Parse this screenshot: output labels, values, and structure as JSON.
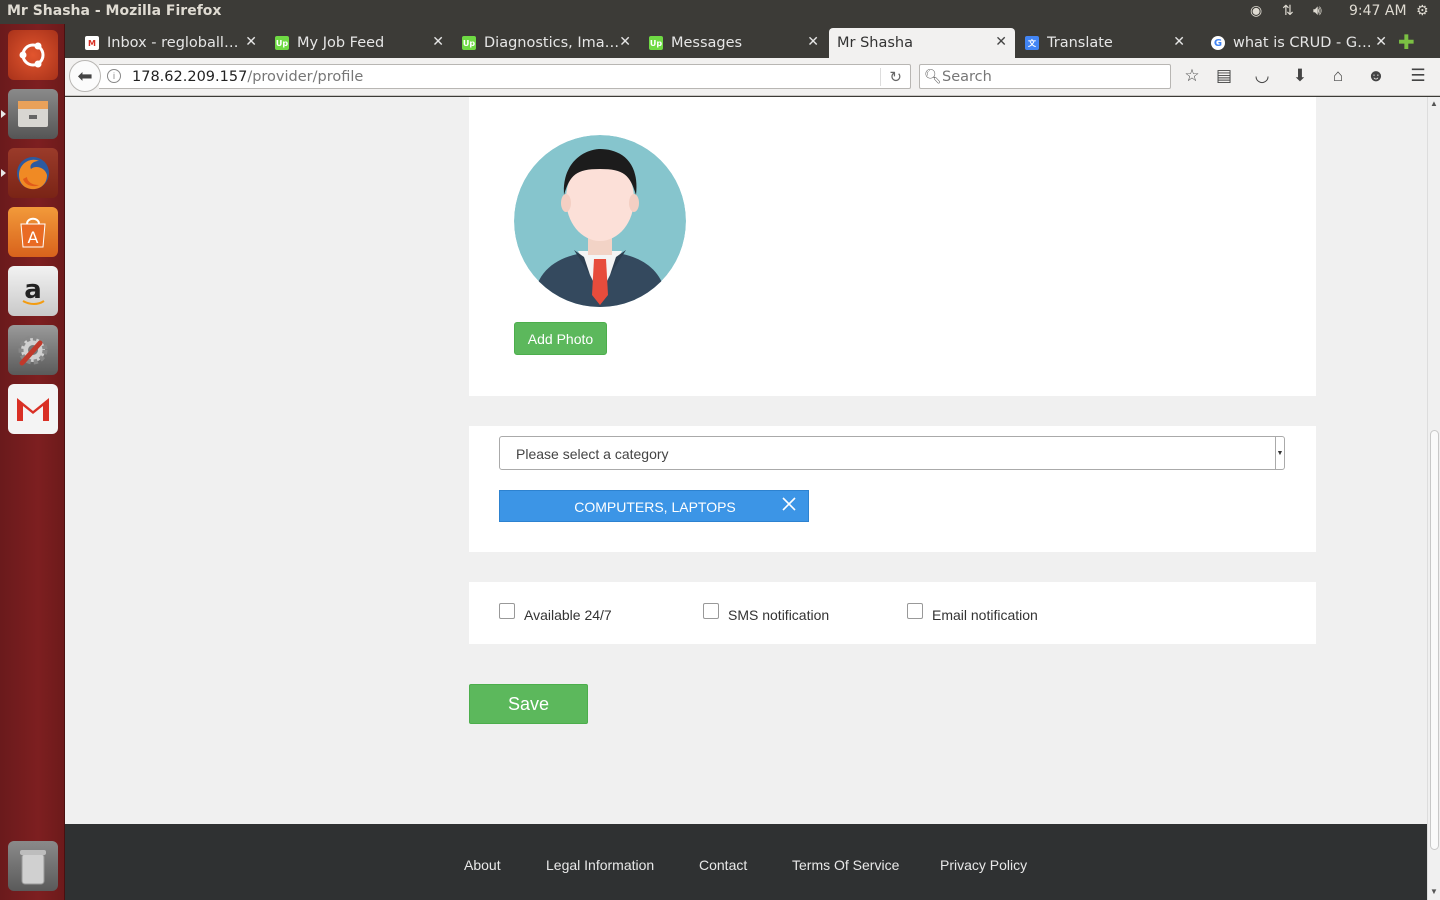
{
  "os": {
    "window_title": "Mr Shasha - Mozilla Firefox",
    "clock": "9:47 AM"
  },
  "launcher": {
    "items": [
      "ubuntu-dash",
      "files",
      "firefox",
      "software-center",
      "amazon",
      "system-settings",
      "gmail",
      "trash"
    ]
  },
  "browser": {
    "tabs": [
      {
        "label": "Inbox - regloball…",
        "icon": "gmail-icon",
        "color": "#d93025"
      },
      {
        "label": "My Job Feed",
        "icon": "upwork-icon",
        "color": "#6fda44"
      },
      {
        "label": "Diagnostics, Ima…",
        "icon": "upwork-icon",
        "color": "#6fda44"
      },
      {
        "label": "Messages",
        "icon": "upwork-icon",
        "color": "#6fda44"
      },
      {
        "label": "Mr Shasha",
        "icon": "none",
        "active": true
      },
      {
        "label": "Translate",
        "icon": "translate-icon",
        "color": "#4285f4"
      },
      {
        "label": "what is CRUD - G…",
        "icon": "google-icon",
        "color": "#4285f4"
      }
    ],
    "url_host": "178.62.209.157",
    "url_path": "/provider/profile",
    "search_placeholder": "Search"
  },
  "page": {
    "add_photo_label": "Add Photo",
    "category_placeholder": "Please select a category",
    "selected_category": "COMPUTERS, LAPTOPS",
    "checkboxes": [
      {
        "label": "Available 24/7",
        "checked": false
      },
      {
        "label": "SMS notification",
        "checked": false
      },
      {
        "label": "Email notification",
        "checked": false
      }
    ],
    "save_label": "Save",
    "accent_green": "#5cb85c",
    "tag_blue": "#3c95e6"
  },
  "footer": {
    "links": [
      "About",
      "Legal Information",
      "Contact",
      "Terms Of Service",
      "Privacy Policy"
    ]
  }
}
